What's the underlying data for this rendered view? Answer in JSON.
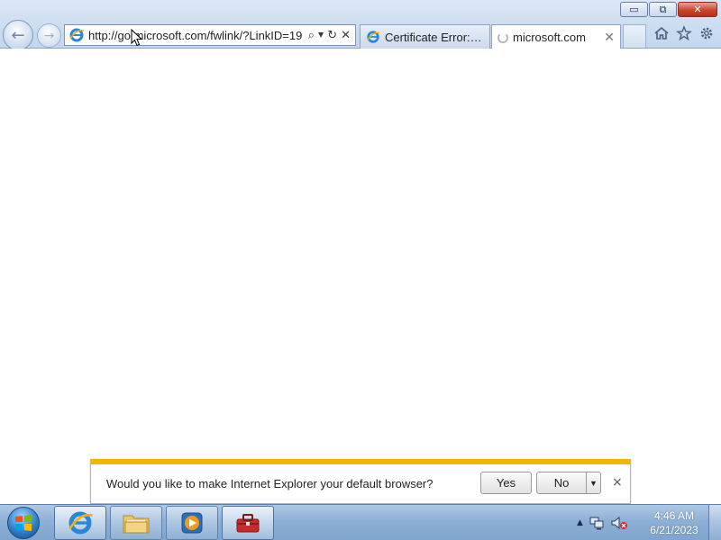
{
  "browser": {
    "address_url": "http://go.microsoft.com/fwlink/?LinkID=19",
    "tabs": [
      {
        "label": "Certificate Error: Na...",
        "state": "inactive"
      },
      {
        "label": "microsoft.com",
        "state": "active-loading"
      }
    ],
    "window_buttons": {
      "minimize": "▭",
      "restore": "⧉",
      "close": "✕"
    }
  },
  "notification": {
    "message": "Would you like to make Internet Explorer your default browser?",
    "yes_label": "Yes",
    "no_label": "No",
    "dropdown_glyph": "▼",
    "close_glyph": "×",
    "accent_color": "#f1b600"
  },
  "taskbar": {
    "time": "4:46 AM",
    "date": "6/21/2023",
    "pinned": [
      "ie-icon",
      "folder-icon",
      "media-player-icon",
      "toolbox-icon"
    ],
    "tray_arrow": "▲"
  }
}
